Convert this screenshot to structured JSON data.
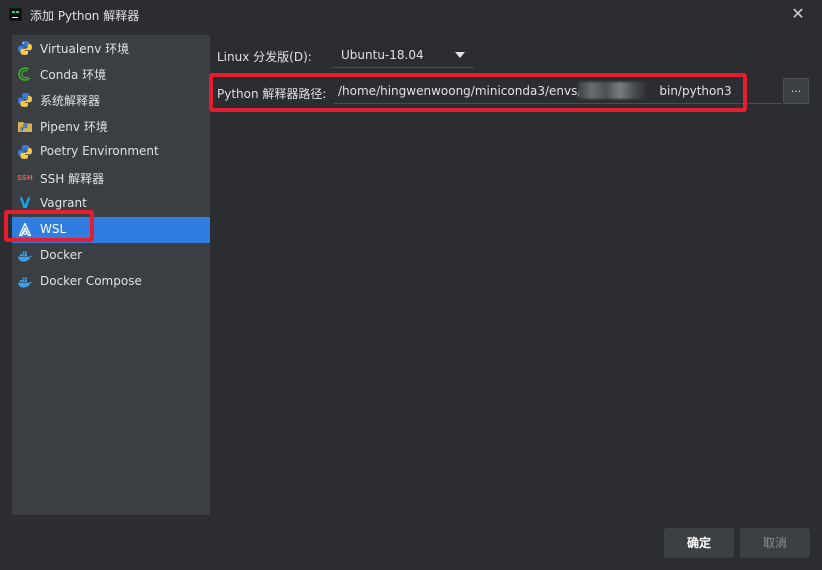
{
  "window": {
    "title": "添加 Python 解释器",
    "close_glyph": "✕"
  },
  "sidebar": {
    "items": [
      {
        "label": "Virtualenv 环境",
        "icon": "python-icon"
      },
      {
        "label": "Conda 环境",
        "icon": "conda-icon"
      },
      {
        "label": "系统解释器",
        "icon": "python-icon"
      },
      {
        "label": "Pipenv 环境",
        "icon": "pipenv-icon"
      },
      {
        "label": "Poetry Environment",
        "icon": "python-icon"
      },
      {
        "label": "SSH 解释器",
        "icon": "ssh-icon",
        "icon_text": "SSH"
      },
      {
        "label": "Vagrant",
        "icon": "vagrant-icon",
        "icon_text": "V"
      },
      {
        "label": "WSL",
        "icon": "linux-icon",
        "selected": true
      },
      {
        "label": "Docker",
        "icon": "docker-icon"
      },
      {
        "label": "Docker Compose",
        "icon": "docker-icon"
      }
    ]
  },
  "form": {
    "distro_label": "Linux 分发版(D):",
    "distro_value": "Ubuntu-18.04",
    "path_label": "Python 解释器路径:",
    "path_value_start": "/home/hingwenwoong/miniconda3/envs/",
    "path_value_end": "bin/python3",
    "browse_label": "..."
  },
  "buttons": {
    "ok": "确定",
    "cancel": "取消"
  },
  "colors": {
    "background": "#2b2d30",
    "sidebar": "#3b3e42",
    "selection": "#2f7de1",
    "highlight_red": "#e51d2f",
    "python_blue": "#3e7bd6",
    "python_yellow": "#f2c94c",
    "conda_green": "#43b02a"
  }
}
